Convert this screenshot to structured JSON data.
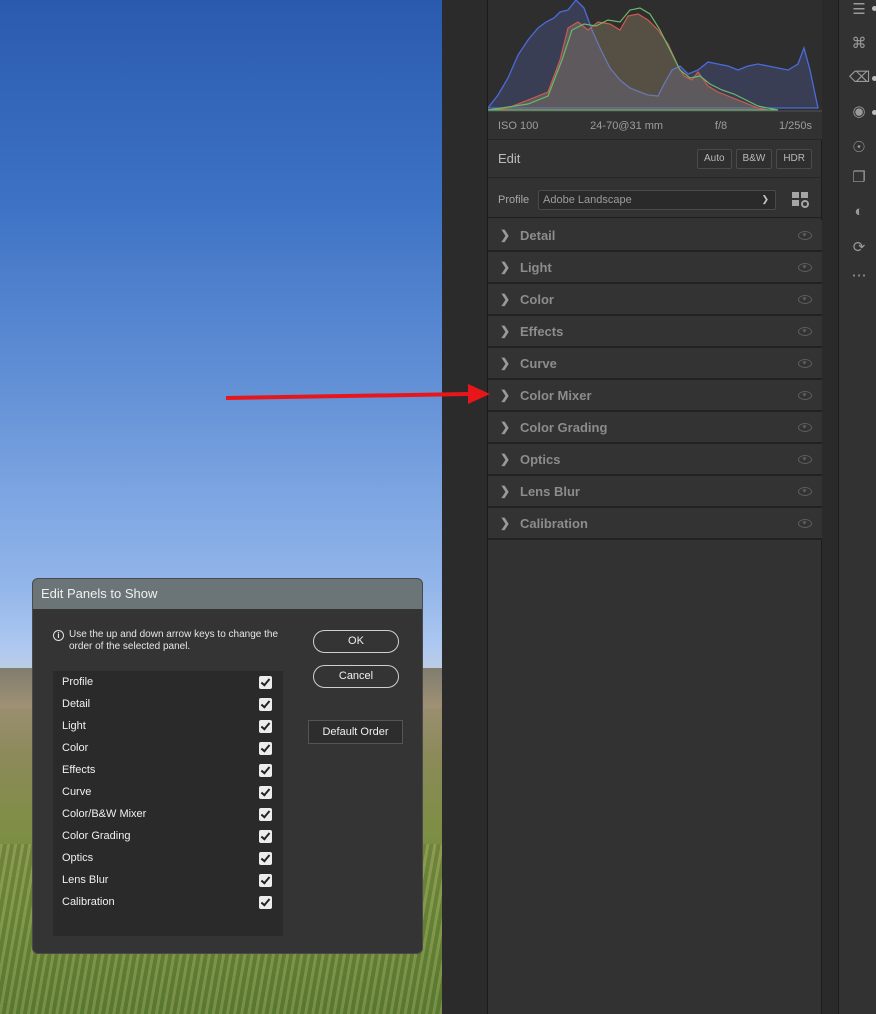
{
  "histogram": {
    "iso": "ISO 100",
    "lens": "24-70@31 mm",
    "aperture": "f/8",
    "shutter": "1/250s"
  },
  "edit": {
    "title": "Edit",
    "buttons": [
      "Auto",
      "B&W",
      "HDR"
    ]
  },
  "profile": {
    "label": "Profile",
    "value": "Adobe Landscape"
  },
  "sections": [
    {
      "label": "Detail"
    },
    {
      "label": "Light"
    },
    {
      "label": "Color"
    },
    {
      "label": "Effects"
    },
    {
      "label": "Curve"
    },
    {
      "label": "Color Mixer"
    },
    {
      "label": "Color Grading"
    },
    {
      "label": "Optics"
    },
    {
      "label": "Lens Blur"
    },
    {
      "label": "Calibration"
    }
  ],
  "annotation": {
    "color": "#e8161b"
  },
  "dialog": {
    "title": "Edit Panels to Show",
    "hint": "Use the up and down arrow keys to change the order of the selected panel.",
    "ok": "OK",
    "cancel": "Cancel",
    "default_order": "Default Order",
    "items": [
      {
        "label": "Profile",
        "checked": true
      },
      {
        "label": "Detail",
        "checked": true
      },
      {
        "label": "Light",
        "checked": true
      },
      {
        "label": "Color",
        "checked": true
      },
      {
        "label": "Effects",
        "checked": true
      },
      {
        "label": "Curve",
        "checked": true
      },
      {
        "label": "Color/B&W Mixer",
        "checked": true
      },
      {
        "label": "Color Grading",
        "checked": true
      },
      {
        "label": "Optics",
        "checked": true
      },
      {
        "label": "Lens Blur",
        "checked": true
      },
      {
        "label": "Calibration",
        "checked": true
      }
    ]
  },
  "toolstrip": {
    "icons": [
      "sliders-icon",
      "crop-icon",
      "eraser-icon",
      "masking-icon",
      "redeye-icon",
      "snapshots-icon",
      "presets-icon",
      "sync-icon",
      "more-icon"
    ]
  }
}
